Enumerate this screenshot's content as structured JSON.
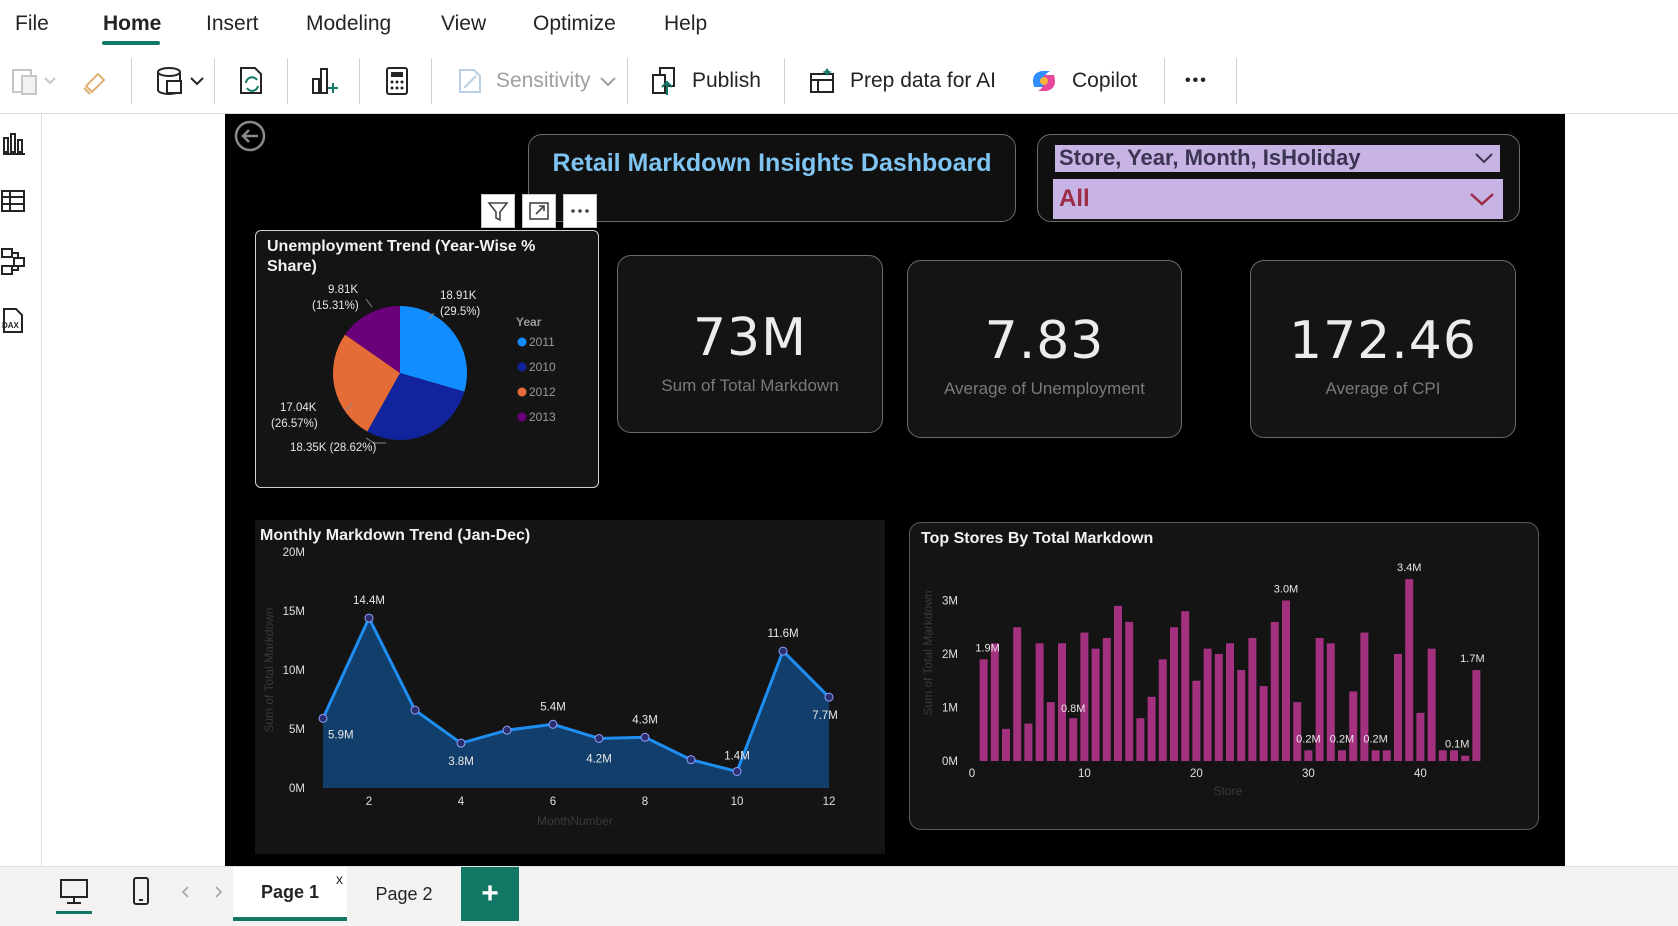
{
  "menu": {
    "items": [
      {
        "label": "File",
        "active": false
      },
      {
        "label": "Home",
        "active": true
      },
      {
        "label": "Insert",
        "active": false
      },
      {
        "label": "Modeling",
        "active": false
      },
      {
        "label": "View",
        "active": false
      },
      {
        "label": "Optimize",
        "active": false
      },
      {
        "label": "Help",
        "active": false
      }
    ]
  },
  "toolbar": {
    "sensitivity_label": "Sensitivity",
    "publish_label": "Publish",
    "prep_data_label": "Prep data for AI",
    "copilot_label": "Copilot",
    "more_label": "•••"
  },
  "colors": {
    "accent": "#117865",
    "series_2011": "#118dff",
    "series_2010": "#12239e",
    "series_2012": "#e66c37",
    "series_2013": "#6b007b",
    "line": "#1f8ef1",
    "area": "#123e6b",
    "bar": "#a3317f"
  },
  "dashboard": {
    "title": "Retail Markdown Insights Dashboard",
    "slicer": {
      "header": "Store, Year, Month, IsHoliday",
      "value": "All"
    },
    "kpis": [
      {
        "value": "73M",
        "label": "Sum of Total Markdown"
      },
      {
        "value": "7.83",
        "label": "Average of Unemployment"
      },
      {
        "value": "172.46",
        "label": "Average of CPI"
      }
    ]
  },
  "pie": {
    "title_line1": "Unemployment Trend (Year-Wise %",
    "title_line2": "Share)",
    "legend_title": "Year",
    "labels": [
      {
        "line1": "18.91K",
        "line2": "(29.5%)"
      },
      {
        "line1": "18.35K (28.62%)",
        "line2": ""
      },
      {
        "line1": "17.04K",
        "line2": "(26.57%)"
      },
      {
        "line1": "9.81K",
        "line2": "(15.31%)"
      }
    ]
  },
  "line_chart": {
    "title": "Monthly Markdown Trend (Jan-Dec)",
    "xlabel": "MonthNumber",
    "ylabel": "Sum of Total Markdown"
  },
  "bar_chart": {
    "title": "Top Stores By Total Markdown",
    "xlabel": "Store",
    "ylabel": "Sum of Total Markdown"
  },
  "chart_data": [
    {
      "type": "pie",
      "title": "Unemployment Trend (Year-Wise % Share)",
      "legend_title": "Year",
      "legend_placement": "right",
      "slices": [
        {
          "name": "2011",
          "value": 18910,
          "percent": 29.5,
          "label": "18.91K (29.5%)",
          "color": "#118dff"
        },
        {
          "name": "2010",
          "value": 18350,
          "percent": 28.62,
          "label": "18.35K (28.62%)",
          "color": "#12239e"
        },
        {
          "name": "2012",
          "value": 17040,
          "percent": 26.57,
          "label": "17.04K (26.57%)",
          "color": "#e66c37"
        },
        {
          "name": "2013",
          "value": 9810,
          "percent": 15.31,
          "label": "9.81K (15.31%)",
          "color": "#6b007b"
        }
      ]
    },
    {
      "type": "area",
      "title": "Monthly Markdown Trend (Jan-Dec)",
      "xlabel": "MonthNumber",
      "ylabel": "Sum of Total Markdown",
      "x": [
        1,
        2,
        3,
        4,
        5,
        6,
        7,
        8,
        9,
        10,
        11,
        12
      ],
      "y": [
        5.9,
        14.4,
        6.6,
        3.8,
        4.9,
        5.4,
        4.2,
        4.3,
        2.4,
        1.4,
        11.6,
        7.7
      ],
      "y_unit": "M",
      "data_labels": {
        "1": "5.9M",
        "2": "14.4M",
        "4": "3.8M",
        "6": "5.4M",
        "7": "4.2M",
        "8": "4.3M",
        "10": "1.4M",
        "11": "11.6M",
        "12": "7.7M"
      },
      "xticks": [
        "2",
        "4",
        "6",
        "8",
        "10",
        "12"
      ],
      "yticks": [
        "0M",
        "5M",
        "10M",
        "15M",
        "20M"
      ],
      "ylim": [
        0,
        20
      ],
      "grid": false
    },
    {
      "type": "bar",
      "title": "Top Stores By Total Markdown",
      "xlabel": "Store",
      "ylabel": "Sum of Total Markdown",
      "x": [
        1,
        2,
        3,
        4,
        5,
        6,
        7,
        8,
        9,
        10,
        11,
        12,
        13,
        14,
        15,
        16,
        17,
        18,
        19,
        20,
        21,
        22,
        23,
        24,
        25,
        26,
        27,
        28,
        29,
        30,
        31,
        32,
        33,
        34,
        35,
        36,
        37,
        38,
        39,
        40,
        41,
        42,
        43,
        44,
        45
      ],
      "values": [
        1.9,
        2.2,
        0.6,
        2.5,
        0.7,
        2.2,
        1.1,
        2.2,
        0.8,
        2.4,
        2.1,
        2.3,
        2.9,
        2.6,
        0.8,
        1.2,
        1.9,
        2.5,
        2.8,
        1.5,
        2.1,
        2.0,
        2.2,
        1.7,
        2.3,
        1.4,
        2.6,
        3.0,
        1.1,
        0.2,
        2.3,
        2.2,
        0.2,
        1.3,
        2.4,
        0.2,
        0.2,
        2.0,
        3.4,
        0.9,
        2.1,
        0.2,
        0.2,
        0.1,
        1.7
      ],
      "data_labels": {
        "1": "1.9M",
        "9": "0.8M",
        "28": "3.0M",
        "30": "0.2M",
        "33": "0.2M",
        "36": "0.2M",
        "39": "3.4M",
        "44": "0.1M",
        "45": "1.7M"
      },
      "xticks": [
        "0",
        "10",
        "20",
        "30",
        "40"
      ],
      "yticks": [
        "0M",
        "1M",
        "2M",
        "3M"
      ],
      "ylim": [
        0,
        3.8
      ],
      "y_unit": "M",
      "grid": false
    }
  ],
  "pages": {
    "tabs": [
      {
        "label": "Page 1",
        "active": true
      },
      {
        "label": "Page 2",
        "active": false
      }
    ],
    "close_mark": "x",
    "add_label": "+"
  }
}
